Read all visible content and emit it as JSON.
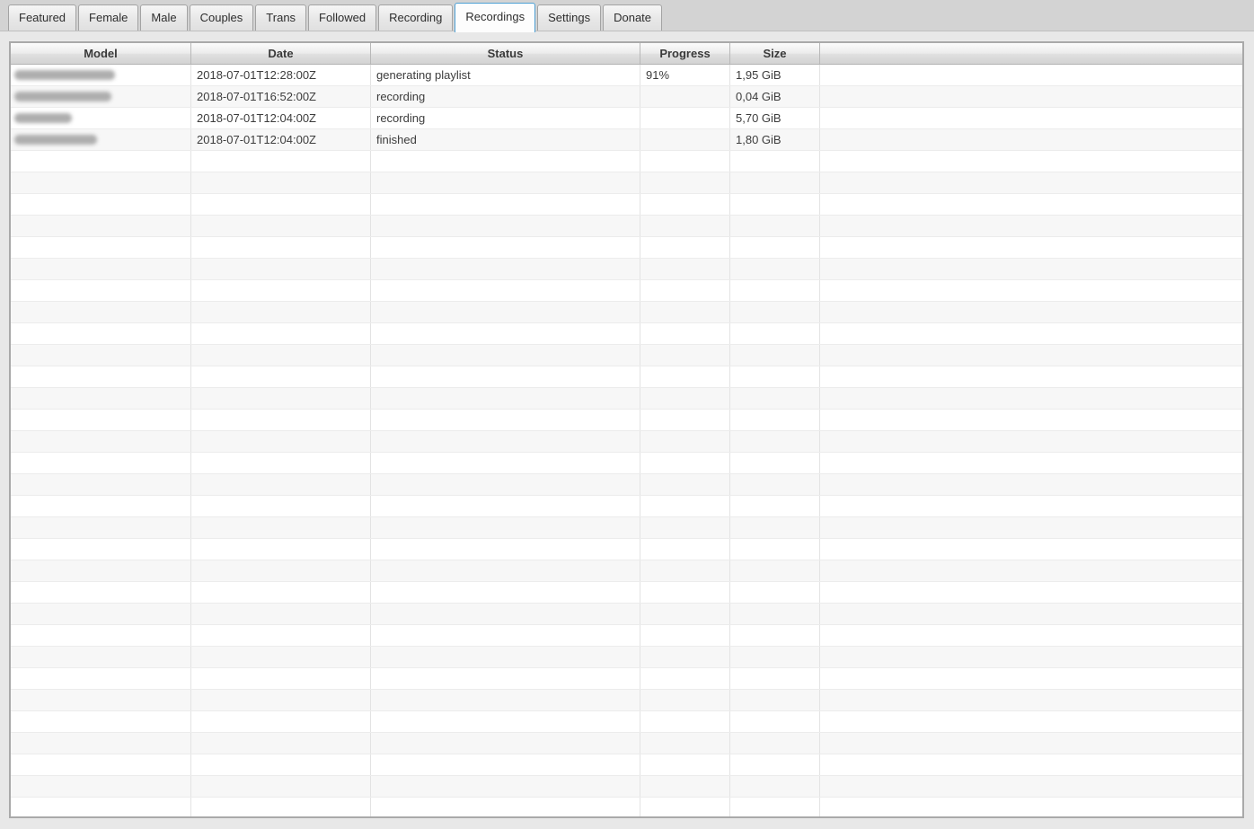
{
  "tabs": [
    {
      "label": "Featured",
      "active": false
    },
    {
      "label": "Female",
      "active": false
    },
    {
      "label": "Male",
      "active": false
    },
    {
      "label": "Couples",
      "active": false
    },
    {
      "label": "Trans",
      "active": false
    },
    {
      "label": "Followed",
      "active": false
    },
    {
      "label": "Recording",
      "active": false
    },
    {
      "label": "Recordings",
      "active": true
    },
    {
      "label": "Settings",
      "active": false
    },
    {
      "label": "Donate",
      "active": false
    }
  ],
  "table": {
    "columns": [
      "Model",
      "Date",
      "Status",
      "Progress",
      "Size",
      ""
    ],
    "rows": [
      {
        "model": "",
        "model_redacted": true,
        "redacted_width": 112,
        "date": "2018-07-01T12:28:00Z",
        "status": "generating playlist",
        "progress": "91%",
        "size": "1,95 GiB"
      },
      {
        "model": "",
        "model_redacted": true,
        "redacted_width": 108,
        "date": "2018-07-01T16:52:00Z",
        "status": "recording",
        "progress": "",
        "size": "0,04 GiB"
      },
      {
        "model": "",
        "model_redacted": true,
        "redacted_width": 64,
        "date": "2018-07-01T12:04:00Z",
        "status": "recording",
        "progress": "",
        "size": "5,70 GiB"
      },
      {
        "model": "",
        "model_redacted": true,
        "redacted_width": 92,
        "date": "2018-07-01T12:04:00Z",
        "status": "finished",
        "progress": "",
        "size": "1,80 GiB"
      }
    ],
    "empty_row_count": 31
  },
  "colors": {
    "active_tab_border": "#4da0d4",
    "window_background": "#e8e8e8",
    "tabbar_background": "#d3d3d3",
    "row_stripe": "#f7f7f7",
    "header_text": "#3a3a3a"
  }
}
